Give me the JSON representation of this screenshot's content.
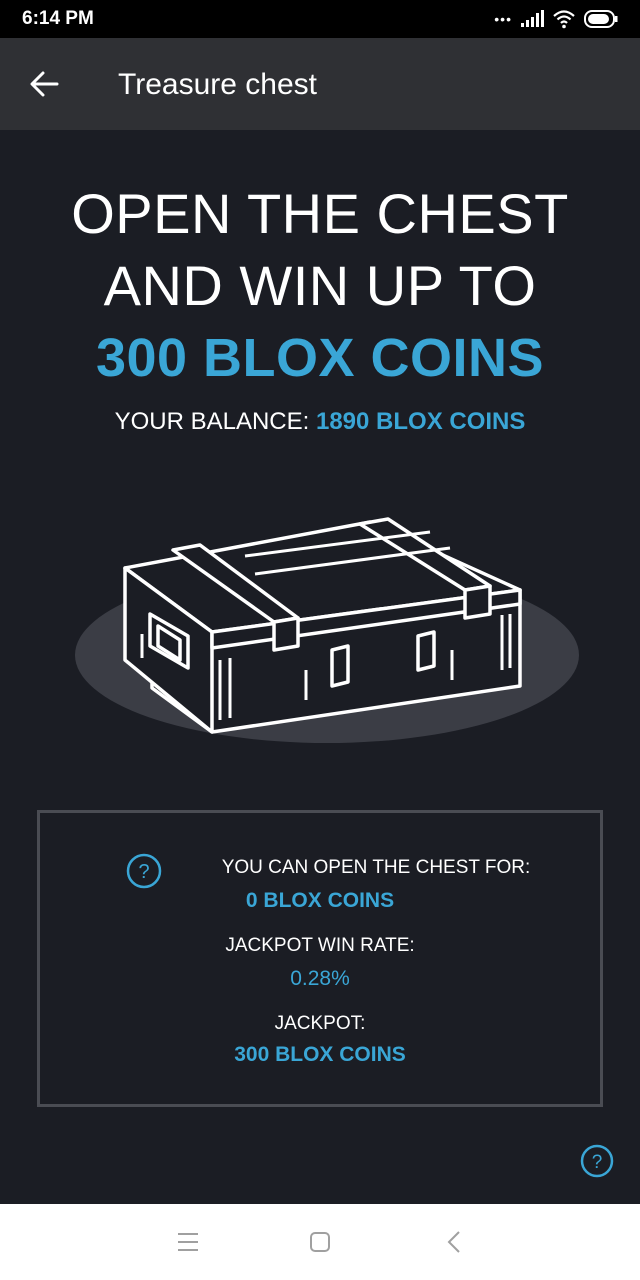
{
  "status": {
    "time": "6:14 PM",
    "dots": "•••"
  },
  "appbar": {
    "title": "Treasure chest"
  },
  "headline": {
    "line1": "OPEN THE CHEST",
    "line2": "AND WIN UP TO",
    "line3": "300 BLOX COINS"
  },
  "balance": {
    "label": "YOUR BALANCE:",
    "value": "1890 BLOX COINS"
  },
  "info": {
    "open_label": "YOU CAN OPEN THE CHEST FOR:",
    "open_value": "0 BLOX COINS",
    "rate_label": "JACKPOT WIN RATE:",
    "rate_value": "0.28%",
    "jackpot_label": "JACKPOT:",
    "jackpot_value": "300 BLOX COINS"
  },
  "colors": {
    "accent": "#3aa6d6",
    "background": "#1b1d24",
    "appbar": "#2f3034"
  },
  "icons": [
    "back-arrow-icon",
    "help-icon",
    "menu-icon",
    "home-icon",
    "back-nav-icon",
    "wifi-icon",
    "battery-icon",
    "signal-icon"
  ]
}
